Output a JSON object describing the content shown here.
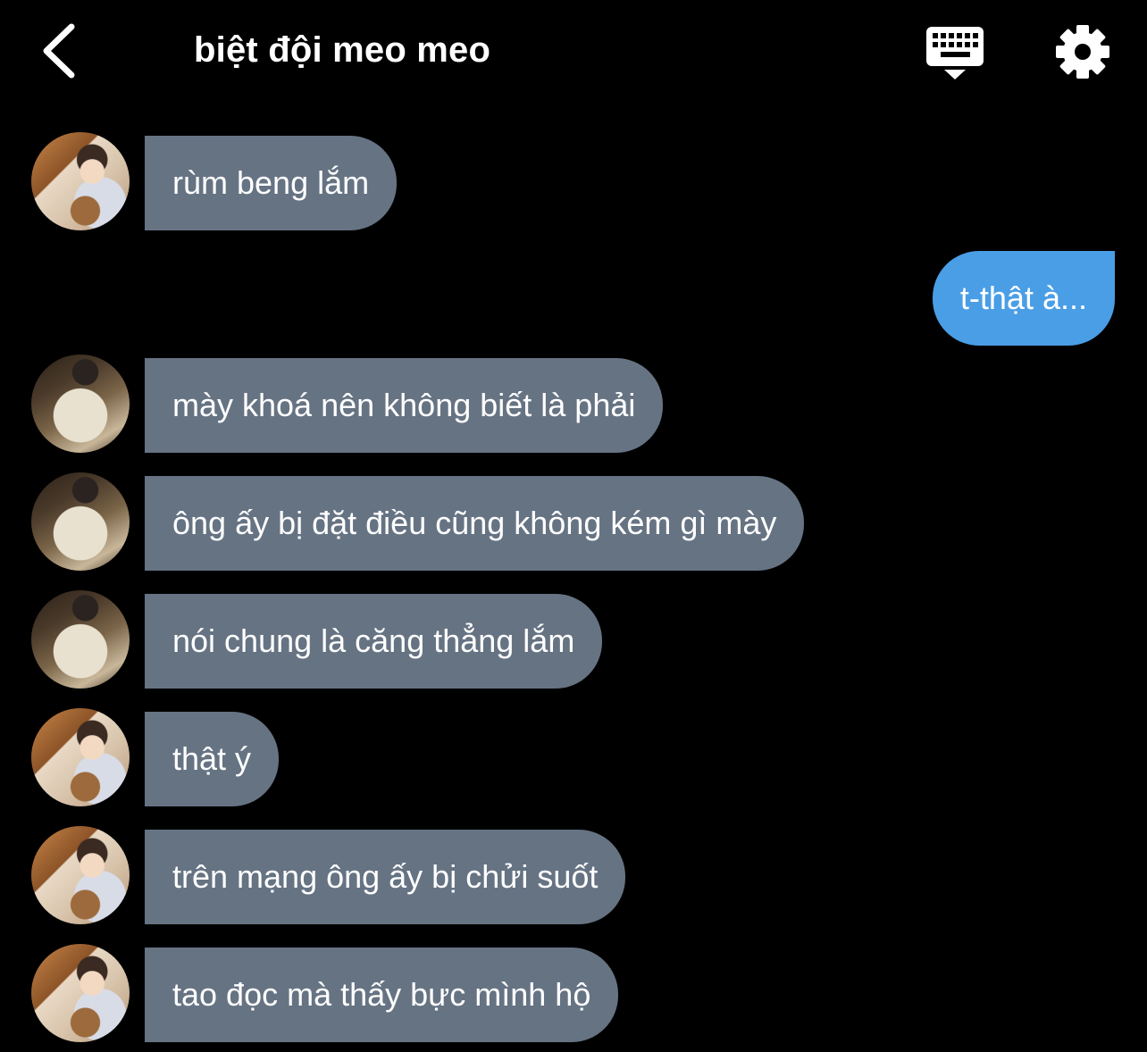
{
  "header": {
    "title": "biệt đội meo meo"
  },
  "colors": {
    "background": "#000000",
    "incoming_bubble": "#667383",
    "outgoing_bubble": "#4a9ee6",
    "text": "#ffffff"
  },
  "icons": {
    "back": "chevron-left-icon",
    "keyboard": "keyboard-hide-icon",
    "settings": "gear-icon"
  },
  "messages": [
    {
      "direction": "in",
      "avatar": "boy",
      "text": "rùm beng lắm"
    },
    {
      "direction": "out",
      "text": "t-thật à..."
    },
    {
      "direction": "in",
      "avatar": "mirror",
      "text": "mày khoá nên không biết là phải"
    },
    {
      "direction": "in",
      "avatar": "mirror",
      "text": "ông ấy bị đặt điều cũng không kém gì mày"
    },
    {
      "direction": "in",
      "avatar": "mirror",
      "text": "nói chung là căng thẳng lắm"
    },
    {
      "direction": "in",
      "avatar": "boy",
      "text": "thật ý"
    },
    {
      "direction": "in",
      "avatar": "boy",
      "text": "trên mạng ông ấy bị chửi suốt"
    },
    {
      "direction": "in",
      "avatar": "boy",
      "text": "tao đọc mà thấy bực mình hộ"
    }
  ]
}
